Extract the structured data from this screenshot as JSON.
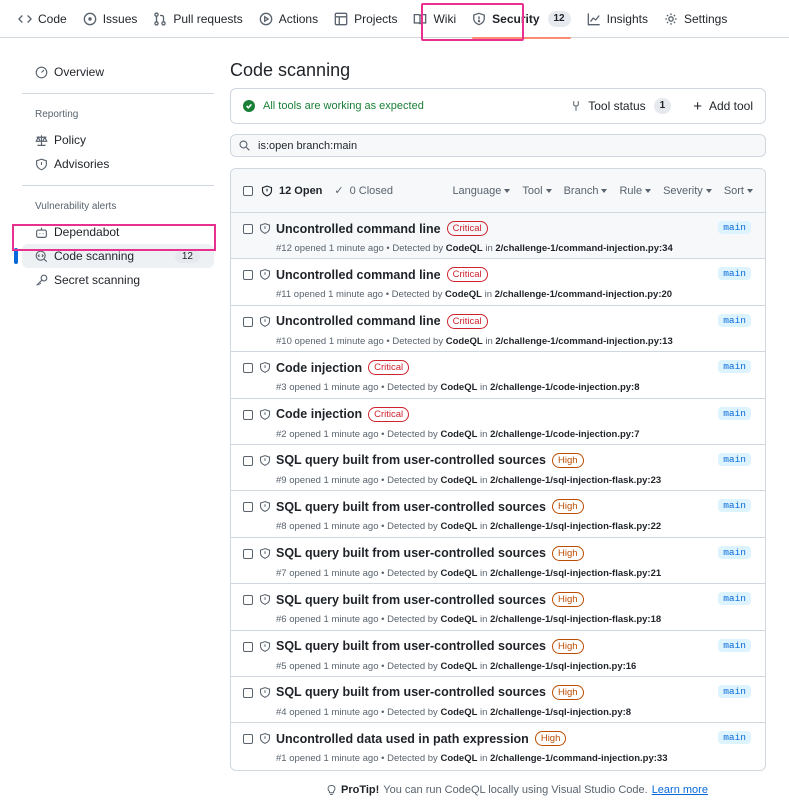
{
  "topnav": {
    "items": [
      {
        "label": "Code",
        "icon": "code-icon"
      },
      {
        "label": "Issues",
        "icon": "issue-opened-icon"
      },
      {
        "label": "Pull requests",
        "icon": "git-pull-request-icon"
      },
      {
        "label": "Actions",
        "icon": "play-icon"
      },
      {
        "label": "Projects",
        "icon": "table-icon"
      },
      {
        "label": "Wiki",
        "icon": "book-icon"
      },
      {
        "label": "Security",
        "icon": "shield-icon",
        "count": "12"
      },
      {
        "label": "Insights",
        "icon": "graph-icon"
      },
      {
        "label": "Settings",
        "icon": "gear-icon"
      }
    ]
  },
  "sidebar": {
    "overview": "Overview",
    "reporting_heading": "Reporting",
    "policy": "Policy",
    "advisories": "Advisories",
    "vuln_heading": "Vulnerability alerts",
    "dependabot": "Dependabot",
    "code_scanning": "Code scanning",
    "code_scanning_count": "12",
    "secret_scanning": "Secret scanning"
  },
  "main": {
    "title": "Code scanning",
    "status_text": "All tools are working as expected",
    "tool_status_label": "Tool status",
    "tool_status_count": "1",
    "add_tool_label": "Add tool",
    "search_value": "is:open branch:main",
    "open_label": "12 Open",
    "closed_label": "0 Closed",
    "filters": [
      "Language",
      "Tool",
      "Branch",
      "Rule",
      "Severity",
      "Sort"
    ]
  },
  "alerts": [
    {
      "title": "Uncontrolled command line",
      "severity": "Critical",
      "num": "#12",
      "path": "2/challenge-1/command-injection.py:34",
      "branch": "main"
    },
    {
      "title": "Uncontrolled command line",
      "severity": "Critical",
      "num": "#11",
      "path": "2/challenge-1/command-injection.py:20",
      "branch": "main"
    },
    {
      "title": "Uncontrolled command line",
      "severity": "Critical",
      "num": "#10",
      "path": "2/challenge-1/command-injection.py:13",
      "branch": "main"
    },
    {
      "title": "Code injection",
      "severity": "Critical",
      "num": "#3",
      "path": "2/challenge-1/code-injection.py:8",
      "branch": "main"
    },
    {
      "title": "Code injection",
      "severity": "Critical",
      "num": "#2",
      "path": "2/challenge-1/code-injection.py:7",
      "branch": "main"
    },
    {
      "title": "SQL query built from user-controlled sources",
      "severity": "High",
      "num": "#9",
      "path": "2/challenge-1/sql-injection-flask.py:23",
      "branch": "main"
    },
    {
      "title": "SQL query built from user-controlled sources",
      "severity": "High",
      "num": "#8",
      "path": "2/challenge-1/sql-injection-flask.py:22",
      "branch": "main"
    },
    {
      "title": "SQL query built from user-controlled sources",
      "severity": "High",
      "num": "#7",
      "path": "2/challenge-1/sql-injection-flask.py:21",
      "branch": "main"
    },
    {
      "title": "SQL query built from user-controlled sources",
      "severity": "High",
      "num": "#6",
      "path": "2/challenge-1/sql-injection-flask.py:18",
      "branch": "main"
    },
    {
      "title": "SQL query built from user-controlled sources",
      "severity": "High",
      "num": "#5",
      "path": "2/challenge-1/sql-injection.py:16",
      "branch": "main"
    },
    {
      "title": "SQL query built from user-controlled sources",
      "severity": "High",
      "num": "#4",
      "path": "2/challenge-1/sql-injection.py:8",
      "branch": "main"
    },
    {
      "title": "Uncontrolled data used in path expression",
      "severity": "High",
      "num": "#1",
      "path": "2/challenge-1/command-injection.py:33",
      "branch": "main"
    }
  ],
  "alert_meta": {
    "opened": "opened 1 minute ago",
    "detected_by": "• Detected by",
    "tool": "CodeQL",
    "in": "in"
  },
  "protip": {
    "label": "ProTip!",
    "text": "You can run CodeQL locally using Visual Studio Code.",
    "link": "Learn more"
  }
}
